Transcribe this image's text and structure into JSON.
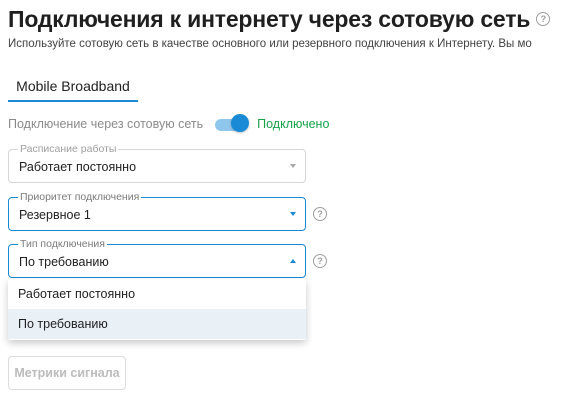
{
  "page": {
    "title": "Подключения к интернету через сотовую сеть",
    "subtitle": "Используйте сотовую сеть в качестве основного или резервного подключения к Интернету. Вы мо"
  },
  "tabs": [
    {
      "label": "Mobile Broadband",
      "active": true
    }
  ],
  "cellular_switch": {
    "label": "Подключение через сотовую сеть",
    "enabled": true,
    "status": "Подключено",
    "status_color": "#17a34a"
  },
  "fields": {
    "schedule": {
      "legend": "Расписание работы",
      "value": "Работает постоянно"
    },
    "priority": {
      "legend": "Приоритет подключения",
      "value": "Резервное 1"
    },
    "connection_type": {
      "legend": "Тип подключения",
      "value": "По требованию",
      "expanded": true,
      "options": [
        "Работает постоянно",
        "По требованию"
      ],
      "selected_option": "По требованию"
    }
  },
  "buttons": {
    "metrics_label": "Метрики сигнала"
  },
  "icons": {
    "help": "?"
  },
  "colors": {
    "accent": "#1a8ad6",
    "success": "#17a34a"
  }
}
